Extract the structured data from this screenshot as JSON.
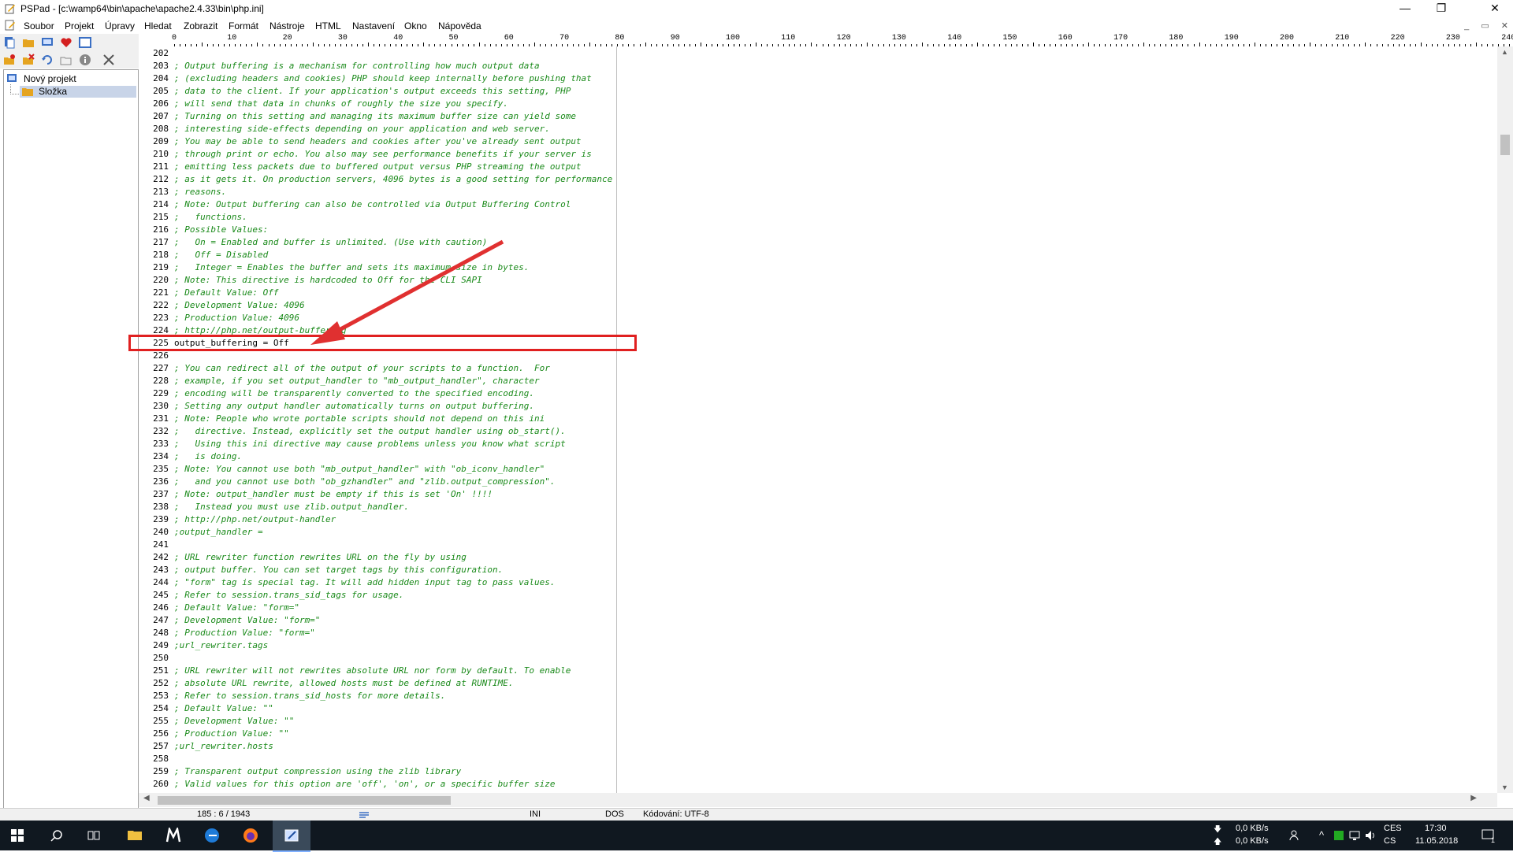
{
  "window": {
    "title": "PSPad - [c:\\wamp64\\bin\\apache\\apache2.4.33\\bin\\php.ini]",
    "minimize": "—",
    "maximize": "❐",
    "close": "✕"
  },
  "menu": [
    "Soubor",
    "Projekt",
    "Úpravy",
    "Hledat",
    "Zobrazit",
    "Formát",
    "Nástroje",
    "HTML",
    "Nastavení",
    "Okno",
    "Nápověda"
  ],
  "project": {
    "root": "Nový projekt",
    "folder": "Složka"
  },
  "ruler": {
    "marks": [
      "0",
      "10",
      "20",
      "30",
      "40",
      "50",
      "60",
      "70",
      "80",
      "90",
      "100",
      "110",
      "120",
      "130",
      "140",
      "150",
      "160",
      "170",
      "180",
      "190",
      "200",
      "210",
      "220",
      "230",
      "240"
    ]
  },
  "editor": {
    "lines": [
      {
        "n": "202",
        "t": "",
        "c": false
      },
      {
        "n": "203",
        "t": "; Output buffering is a mechanism for controlling how much output data",
        "c": true
      },
      {
        "n": "204",
        "t": "; (excluding headers and cookies) PHP should keep internally before pushing that",
        "c": true
      },
      {
        "n": "205",
        "t": "; data to the client. If your application's output exceeds this setting, PHP",
        "c": true
      },
      {
        "n": "206",
        "t": "; will send that data in chunks of roughly the size you specify.",
        "c": true
      },
      {
        "n": "207",
        "t": "; Turning on this setting and managing its maximum buffer size can yield some",
        "c": true
      },
      {
        "n": "208",
        "t": "; interesting side-effects depending on your application and web server.",
        "c": true
      },
      {
        "n": "209",
        "t": "; You may be able to send headers and cookies after you've already sent output",
        "c": true
      },
      {
        "n": "210",
        "t": "; through print or echo. You also may see performance benefits if your server is",
        "c": true
      },
      {
        "n": "211",
        "t": "; emitting less packets due to buffered output versus PHP streaming the output",
        "c": true
      },
      {
        "n": "212",
        "t": "; as it gets it. On production servers, 4096 bytes is a good setting for performance",
        "c": true
      },
      {
        "n": "213",
        "t": "; reasons.",
        "c": true
      },
      {
        "n": "214",
        "t": "; Note: Output buffering can also be controlled via Output Buffering Control",
        "c": true
      },
      {
        "n": "215",
        "t": ";   functions.",
        "c": true
      },
      {
        "n": "216",
        "t": "; Possible Values:",
        "c": true
      },
      {
        "n": "217",
        "t": ";   On = Enabled and buffer is unlimited. (Use with caution)",
        "c": true
      },
      {
        "n": "218",
        "t": ";   Off = Disabled",
        "c": true
      },
      {
        "n": "219",
        "t": ";   Integer = Enables the buffer and sets its maximum size in bytes.",
        "c": true
      },
      {
        "n": "220",
        "t": "; Note: This directive is hardcoded to Off for the CLI SAPI",
        "c": true
      },
      {
        "n": "221",
        "t": "; Default Value: Off",
        "c": true
      },
      {
        "n": "222",
        "t": "; Development Value: 4096",
        "c": true
      },
      {
        "n": "223",
        "t": "; Production Value: 4096",
        "c": true
      },
      {
        "n": "224",
        "t": "; http://php.net/output-buffering",
        "c": true
      },
      {
        "n": "225",
        "t": "output_buffering = Off",
        "c": false
      },
      {
        "n": "226",
        "t": "",
        "c": false
      },
      {
        "n": "227",
        "t": "; You can redirect all of the output of your scripts to a function.  For",
        "c": true
      },
      {
        "n": "228",
        "t": "; example, if you set output_handler to \"mb_output_handler\", character",
        "c": true
      },
      {
        "n": "229",
        "t": "; encoding will be transparently converted to the specified encoding.",
        "c": true
      },
      {
        "n": "230",
        "t": "; Setting any output handler automatically turns on output buffering.",
        "c": true
      },
      {
        "n": "231",
        "t": "; Note: People who wrote portable scripts should not depend on this ini",
        "c": true
      },
      {
        "n": "232",
        "t": ";   directive. Instead, explicitly set the output handler using ob_start().",
        "c": true
      },
      {
        "n": "233",
        "t": ";   Using this ini directive may cause problems unless you know what script",
        "c": true
      },
      {
        "n": "234",
        "t": ";   is doing.",
        "c": true
      },
      {
        "n": "235",
        "t": "; Note: You cannot use both \"mb_output_handler\" with \"ob_iconv_handler\"",
        "c": true
      },
      {
        "n": "236",
        "t": ";   and you cannot use both \"ob_gzhandler\" and \"zlib.output_compression\".",
        "c": true
      },
      {
        "n": "237",
        "t": "; Note: output_handler must be empty if this is set 'On' !!!!",
        "c": true
      },
      {
        "n": "238",
        "t": ";   Instead you must use zlib.output_handler.",
        "c": true
      },
      {
        "n": "239",
        "t": "; http://php.net/output-handler",
        "c": true
      },
      {
        "n": "240",
        "t": ";output_handler =",
        "c": true
      },
      {
        "n": "241",
        "t": "",
        "c": false
      },
      {
        "n": "242",
        "t": "; URL rewriter function rewrites URL on the fly by using",
        "c": true
      },
      {
        "n": "243",
        "t": "; output buffer. You can set target tags by this configuration.",
        "c": true
      },
      {
        "n": "244",
        "t": "; \"form\" tag is special tag. It will add hidden input tag to pass values.",
        "c": true
      },
      {
        "n": "245",
        "t": "; Refer to session.trans_sid_tags for usage.",
        "c": true
      },
      {
        "n": "246",
        "t": "; Default Value: \"form=\"",
        "c": true
      },
      {
        "n": "247",
        "t": "; Development Value: \"form=\"",
        "c": true
      },
      {
        "n": "248",
        "t": "; Production Value: \"form=\"",
        "c": true
      },
      {
        "n": "249",
        "t": ";url_rewriter.tags",
        "c": true
      },
      {
        "n": "250",
        "t": "",
        "c": false
      },
      {
        "n": "251",
        "t": "; URL rewriter will not rewrites absolute URL nor form by default. To enable",
        "c": true
      },
      {
        "n": "252",
        "t": "; absolute URL rewrite, allowed hosts must be defined at RUNTIME.",
        "c": true
      },
      {
        "n": "253",
        "t": "; Refer to session.trans_sid_hosts for more details.",
        "c": true
      },
      {
        "n": "254",
        "t": "; Default Value: \"\"",
        "c": true
      },
      {
        "n": "255",
        "t": "; Development Value: \"\"",
        "c": true
      },
      {
        "n": "256",
        "t": "; Production Value: \"\"",
        "c": true
      },
      {
        "n": "257",
        "t": ";url_rewriter.hosts",
        "c": true
      },
      {
        "n": "258",
        "t": "",
        "c": false
      },
      {
        "n": "259",
        "t": "; Transparent output compression using the zlib library",
        "c": true
      },
      {
        "n": "260",
        "t": "; Valid values for this option are 'off', 'on', or a specific buffer size",
        "c": true
      }
    ]
  },
  "statusbar": {
    "position": "185 : 6 / 1943",
    "syntax": "INI",
    "lineend": "DOS",
    "encoding": "Kódování: UTF-8"
  },
  "taskbar": {
    "net_up": "0,0 KB/s",
    "net_down": "0,0 KB/s",
    "lang1": "CES",
    "lang2": "CS",
    "time": "17:30",
    "date": "11.05.2018",
    "notif_count": "1"
  },
  "colors": {
    "comment": "#1a8a1a",
    "highlight_box": "#e02020",
    "annotation_arrow": "#e03030"
  }
}
